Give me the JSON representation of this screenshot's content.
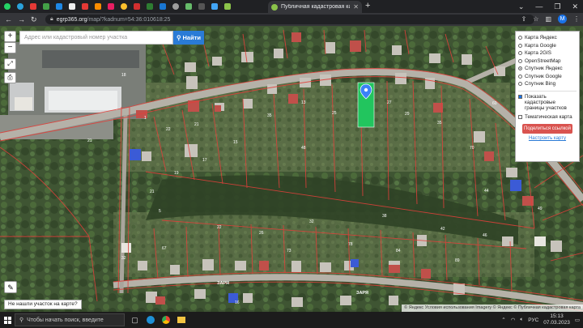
{
  "browser": {
    "active_tab_title": "Публичная кадастровая карта",
    "url_domain": "egrp365.org",
    "url_path": "/map/?kadnum=54:36:010618:25"
  },
  "map": {
    "search_placeholder": "Адрес или кадастровый номер участка",
    "search_button": "Найти",
    "zoom_in": "+",
    "zoom_out": "−",
    "layers": [
      {
        "label": "Карта Яндекс",
        "selected": false
      },
      {
        "label": "Карта Google",
        "selected": false
      },
      {
        "label": "Карта 2GIS",
        "selected": false
      },
      {
        "label": "OpenStreetMap",
        "selected": false
      },
      {
        "label": "Спутник Яндекс",
        "selected": true
      },
      {
        "label": "Спутник Google",
        "selected": false
      },
      {
        "label": "Спутник Bing",
        "selected": false
      }
    ],
    "option_boundaries": "Показать кадастровые границы участков",
    "option_thematic": "Тематическая карта",
    "share_button": "Поделиться ссылкой",
    "settings_link": "Настроить карту",
    "not_found_text": "Не нашли участок на карте?",
    "attribution": "© Яндекс Условия использования  Imagery © Яндекс  © Публичная кадастровая карта",
    "street_label": "ЗАРЯ"
  },
  "taskbar": {
    "search_placeholder": "Чтобы начать поиск, введите",
    "language": "РУС",
    "time": "15:13",
    "date": "07.03.2023"
  },
  "colors": {
    "parcel_highlight": "#22c55e",
    "boundary": "#e0403a",
    "share_button": "#d9534f",
    "search_button": "#2a7bd6"
  }
}
